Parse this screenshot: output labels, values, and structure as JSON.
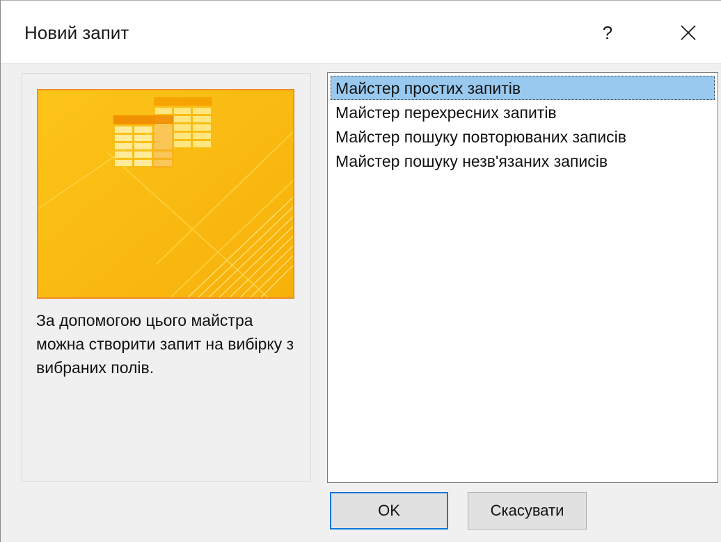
{
  "window": {
    "title": "Новий запит",
    "help_label": "?"
  },
  "left_panel": {
    "description": "За допомогою цього майстра можна створити запит на вибірку з вибраних полів.",
    "illustration_icon": "query-table-illustration-icon"
  },
  "wizard_list": {
    "items": [
      {
        "label": "Майстер простих запитів",
        "selected": true
      },
      {
        "label": "Майстер перехресних запитів",
        "selected": false
      },
      {
        "label": "Майстер пошуку повторюваних записів",
        "selected": false
      },
      {
        "label": "Майстер пошуку незв'язаних записів",
        "selected": false
      }
    ]
  },
  "buttons": {
    "ok_label": "OK",
    "cancel_label": "Скасувати"
  },
  "colors": {
    "accent_border": "#0078d7",
    "selection": "#99c9ef",
    "preview_border": "#f28c28",
    "preview_fill": "#fbbd0c"
  }
}
